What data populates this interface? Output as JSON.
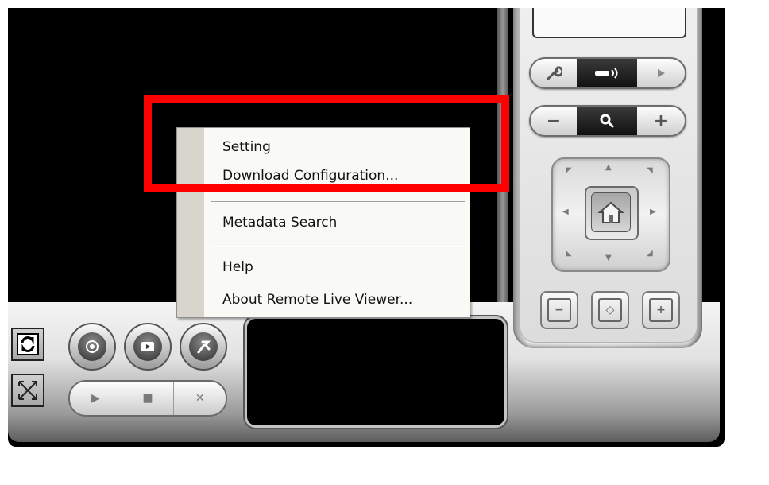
{
  "context_menu": {
    "items": [
      {
        "label": "Setting"
      },
      {
        "label": "Download Configuration..."
      },
      {
        "label": "Metadata Search"
      },
      {
        "label": "Help"
      },
      {
        "label": "About Remote Live Viewer..."
      }
    ]
  },
  "control_panel": {
    "top_row": {
      "left_icon": "wrench-icon",
      "center_icon": "speaker-icon",
      "right_icon": "play-icon"
    },
    "zoom_row": {
      "minus_glyph": "−",
      "center_icon": "magnifier-icon",
      "plus_glyph": "+"
    },
    "ptz_buttons": {
      "home_icon": "home-icon"
    },
    "preset_buttons": [
      {
        "icon": "zoom-out-frame-icon",
        "glyph": "−"
      },
      {
        "icon": "auto-focus-frame-icon",
        "glyph": "◇"
      },
      {
        "icon": "zoom-in-frame-icon",
        "glyph": "+"
      }
    ]
  },
  "bottom_controls": {
    "left_squares": [
      "refresh-icon",
      "fullscreen-x-icon"
    ],
    "round_buttons": [
      "record-icon",
      "playback-icon",
      "tools-icon"
    ],
    "playback_bar": {
      "play_glyph": "▶",
      "stop_glyph": "■",
      "close_glyph": "✕"
    }
  },
  "colors": {
    "highlight": "#ff0000",
    "video_background": "#000000",
    "menu_gutter": "#d8d6cc"
  }
}
